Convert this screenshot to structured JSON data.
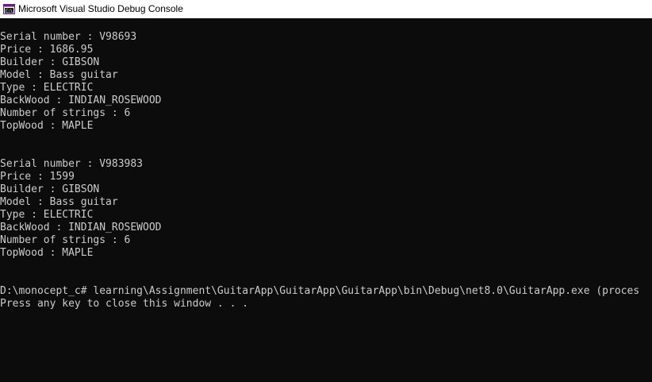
{
  "window": {
    "title": "Microsoft Visual Studio Debug Console",
    "icon": "console-app-icon"
  },
  "console": {
    "lines": [
      "Serial number : V98693",
      "Price : 1686.95",
      "Builder : GIBSON",
      "Model : Bass guitar",
      "Type : ELECTRIC",
      "BackWood : INDIAN_ROSEWOOD",
      "Number of strings : 6",
      "TopWood : MAPLE",
      "",
      "",
      "Serial number : V983983",
      "Price : 1599",
      "Builder : GIBSON",
      "Model : Bass guitar",
      "Type : ELECTRIC",
      "BackWood : INDIAN_ROSEWOOD",
      "Number of strings : 6",
      "TopWood : MAPLE",
      "",
      "",
      "D:\\monocept_c# learning\\Assignment\\GuitarApp\\GuitarApp\\GuitarApp\\bin\\Debug\\net8.0\\GuitarApp.exe (proces",
      "Press any key to close this window . . ."
    ]
  },
  "colors": {
    "background": "#0c0c0c",
    "text": "#cccccc",
    "titlebar": "#ffffff",
    "icon_accent": "#68217a"
  }
}
